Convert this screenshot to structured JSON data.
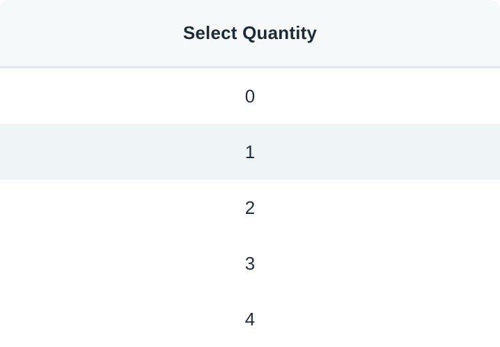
{
  "picker": {
    "title": "Select Quantity",
    "highlighted_index": 1,
    "options": [
      {
        "label": "0"
      },
      {
        "label": "1"
      },
      {
        "label": "2"
      },
      {
        "label": "3"
      },
      {
        "label": "4"
      }
    ]
  },
  "colors": {
    "header_background": "#f6f9fa",
    "header_divider": "#dfe7ec",
    "highlight_background": "#eff4f6",
    "text": "#1f2d3d"
  }
}
